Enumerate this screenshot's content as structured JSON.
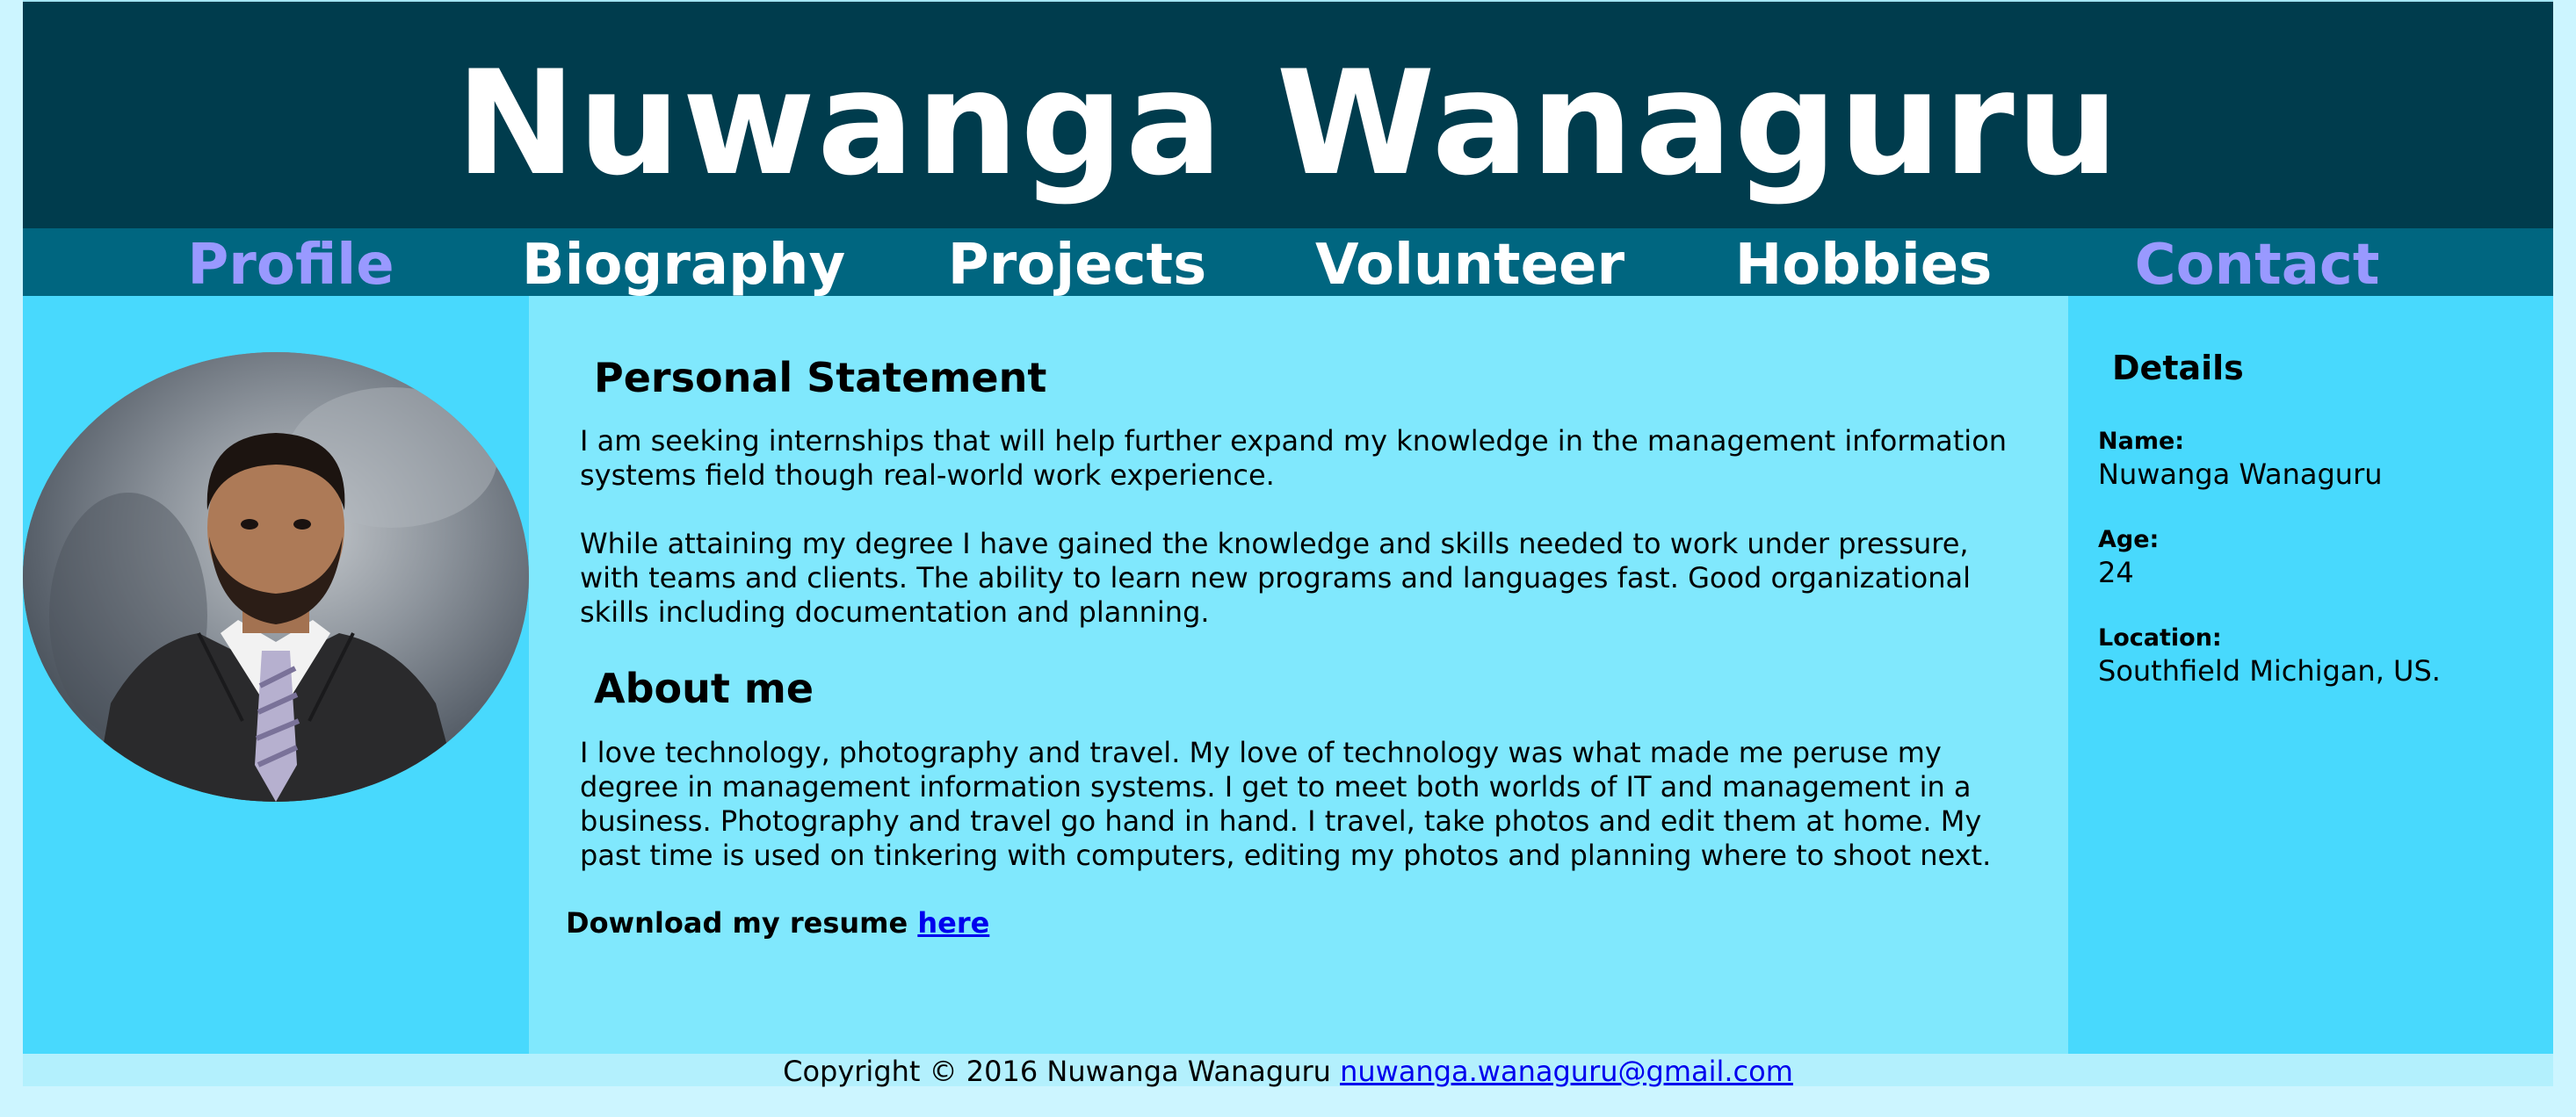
{
  "site": {
    "title": "Nuwanga Wanaguru"
  },
  "nav": {
    "items": [
      {
        "label": "Profile",
        "accent": true
      },
      {
        "label": "Biography",
        "accent": false
      },
      {
        "label": "Projects",
        "accent": false
      },
      {
        "label": "Volunteer",
        "accent": false
      },
      {
        "label": "Hobbies",
        "accent": false
      },
      {
        "label": "Contact",
        "accent": true
      }
    ]
  },
  "main": {
    "statement_heading": "Personal Statement",
    "statement_p1": "I am seeking internships that will help further expand my knowledge in the management information systems field though real-world work experience.",
    "statement_p2": "While attaining my degree I have gained the knowledge and skills needed to work under pressure, with teams and clients. The ability to learn new programs and languages fast. Good organizational skills including documentation and planning.",
    "about_heading": "About me",
    "about_p": "I love technology, photography and travel. My love of technology was what made me peruse my degree in management information systems. I get to meet both worlds of IT and management in a business. Photography and travel go hand in hand. I travel, take photos and edit them at home. My past time is used on tinkering with computers, editing my photos and planning where to shoot next.",
    "resume_text": "Download my resume",
    "resume_link": "here"
  },
  "details": {
    "heading": "Details",
    "name_label": "Name:",
    "name_value": "Nuwanga Wanaguru",
    "age_label": "Age:",
    "age_value": "24",
    "location_label": "Location:",
    "location_value": "Southfield Michigan, US."
  },
  "footer": {
    "copyright": "Copyright © 2016 Nuwanga Wanaguru",
    "email": "nuwanga.wanaguru@gmail.com"
  },
  "colors": {
    "header_bg": "#003c4d",
    "nav_bg": "#006680",
    "nav_accent": "#9999ff",
    "side_bg": "#48d9fd",
    "center_bg": "#80e8fd",
    "page_bg": "#ccf5ff"
  }
}
